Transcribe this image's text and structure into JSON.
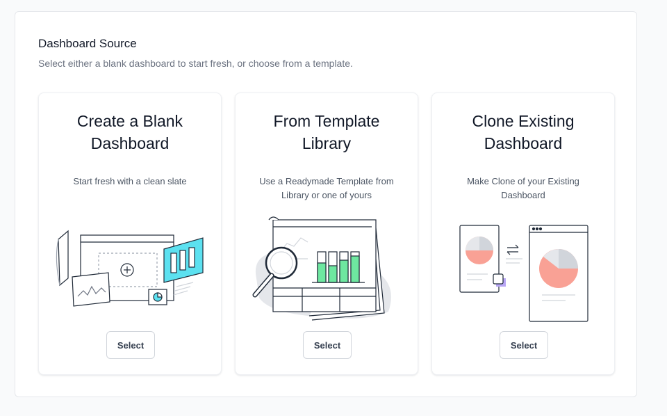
{
  "section": {
    "title": "Dashboard Source",
    "subtitle": "Select either a blank dashboard to start fresh, or choose from a template."
  },
  "cards": [
    {
      "title": "Create a Blank Dashboard",
      "description": "Start fresh with a clean slate",
      "icon": "blank-dashboard-illustration",
      "button_label": "Select"
    },
    {
      "title": "From Template Library",
      "description": "Use a Readymade Template from Library or one of yours",
      "icon": "template-library-illustration",
      "button_label": "Select"
    },
    {
      "title": "Clone Existing Dashboard",
      "description": "Make Clone of your Existing Dashboard",
      "icon": "clone-dashboard-illustration",
      "button_label": "Select"
    }
  ],
  "colors": {
    "accent_cyan": "#5ce1f0",
    "accent_green": "#6ee7a0",
    "accent_coral": "#f9a195",
    "accent_purple": "#b9a7f5",
    "line": "#1f2937"
  }
}
